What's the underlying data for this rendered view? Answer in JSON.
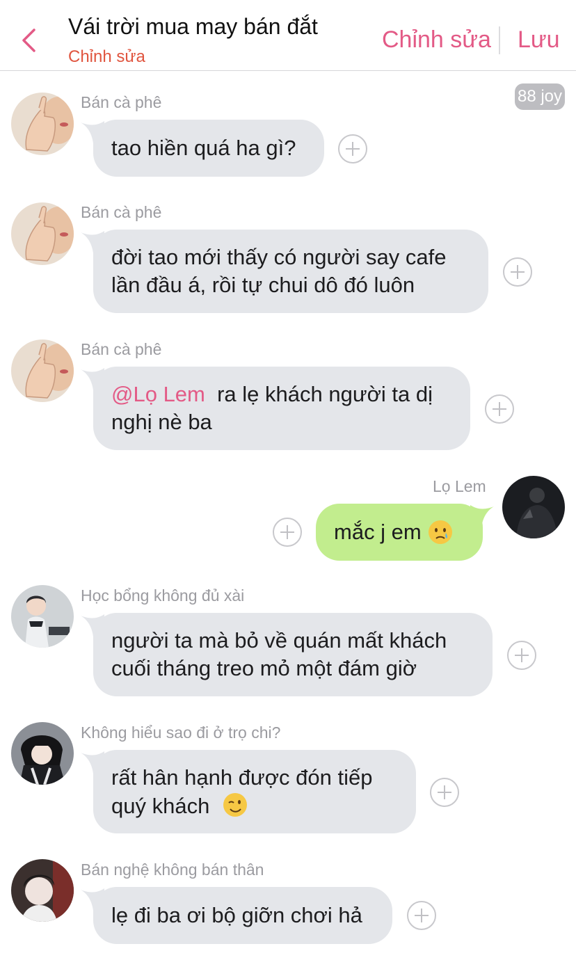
{
  "header": {
    "title": "Vái trời mua may bán đắt",
    "subtitle": "Chỉnh sửa",
    "edit_label": "Chỉnh sửa",
    "save_label": "Lưu",
    "back_icon": "chevron-left-icon",
    "accent_color": "#e35a86"
  },
  "joy_badge": "88 joy",
  "messages": [
    {
      "sender": "Bán cà phê",
      "lines": [
        "tao hiền quá ha gì?"
      ]
    },
    {
      "sender": "Bán cà phê",
      "lines": [
        "đời tao mới thấy có người say cafe",
        "lần đầu á, rồi tự chui dô đó luôn"
      ]
    },
    {
      "sender": "Bán cà phê",
      "mention": "@Lọ Lem",
      "lines": [
        "ra lẹ khách người ta dị",
        "nghị nè ba"
      ]
    },
    {
      "sender": "Lọ Lem",
      "mine": true,
      "lines": [
        "mắc j em"
      ],
      "emoji": "crying-face-emoji"
    },
    {
      "sender": "Học bổng không đủ xài",
      "lines": [
        "người ta mà bỏ về quán mất khách",
        "cuối tháng treo mỏ một đám giờ"
      ]
    },
    {
      "sender": "Không hiểu sao đi ở trọ chi?",
      "lines": [
        "rất hân hạnh được đón tiếp",
        "quý khách"
      ],
      "emoji": "winking-face-emoji"
    },
    {
      "sender": "Bán nghệ không bán thân",
      "lines": [
        "lẹ đi ba ơi bộ giỡn chơi hả"
      ]
    }
  ],
  "colors": {
    "incoming_bubble": "#e4e6ea",
    "outgoing_bubble": "#c2ed8e",
    "sender_text": "#9b9ba0",
    "subtitle": "#e0553f"
  }
}
